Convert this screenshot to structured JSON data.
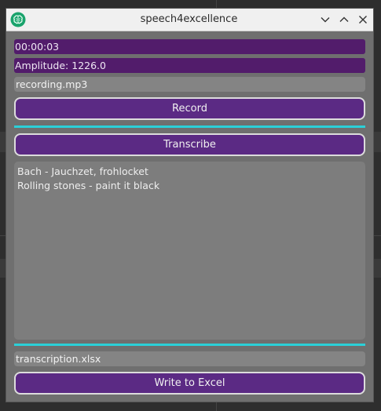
{
  "window": {
    "title": "speech4excellence",
    "icon": "brain-icon",
    "controls": [
      "chevron-down-icon",
      "chevron-up-icon",
      "close-icon"
    ]
  },
  "timer": {
    "value": "00:00:03"
  },
  "amplitude": {
    "label": "Amplitude: 1226.0"
  },
  "recording_file": {
    "value": "recording.mp3"
  },
  "record_button": {
    "label": "Record"
  },
  "transcribe_button": {
    "label": "Transcribe"
  },
  "transcription_text": {
    "lines": [
      "Bach - Jauchzet, frohlocket",
      "Rolling stones - paint it black"
    ]
  },
  "output_file": {
    "value": "transcription.xlsx"
  },
  "excel_button": {
    "label": "Write to Excel"
  },
  "colors": {
    "accent_purple": "#5b2a84",
    "field_purple": "#521c6b",
    "divider_cyan": "#2bd0d8",
    "icon_green": "#1aa36c"
  }
}
